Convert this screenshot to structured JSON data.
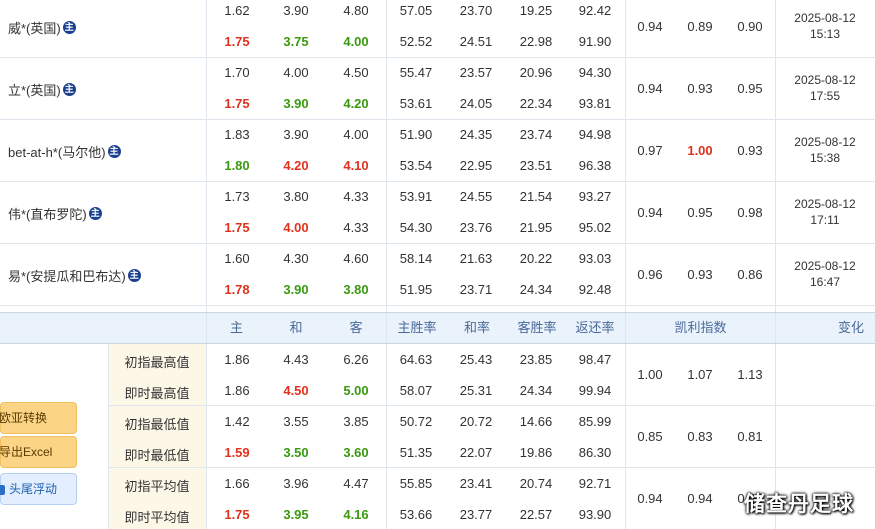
{
  "companies": [
    {
      "name": "威*(英国)",
      "badge": "主",
      "init": [
        "1.62",
        "3.90",
        "4.80",
        "57.05",
        "23.70",
        "19.25",
        "92.42"
      ],
      "live": [
        "1.75",
        "3.75",
        "4.00",
        "52.52",
        "24.51",
        "22.98",
        "91.90"
      ],
      "kelly": [
        "0.94",
        "0.89",
        "0.90"
      ],
      "date": "2025-08-12",
      "time": "15:13"
    },
    {
      "name": "立*(英国)",
      "badge": "主",
      "init": [
        "1.70",
        "4.00",
        "4.50",
        "55.47",
        "23.57",
        "20.96",
        "94.30"
      ],
      "live": [
        "1.75",
        "3.90",
        "4.20",
        "53.61",
        "24.05",
        "22.34",
        "93.81"
      ],
      "kelly": [
        "0.94",
        "0.93",
        "0.95"
      ],
      "date": "2025-08-12",
      "time": "17:55"
    },
    {
      "name": "bet-at-h*(马尔他)",
      "badge": "主",
      "init": [
        "1.83",
        "3.90",
        "4.00",
        "51.90",
        "24.35",
        "23.74",
        "94.98"
      ],
      "live": [
        "1.80",
        "4.20",
        "4.10",
        "53.54",
        "22.95",
        "23.51",
        "96.38"
      ],
      "kelly": [
        "0.97",
        "1.00",
        "0.93"
      ],
      "date": "2025-08-12",
      "time": "15:38"
    },
    {
      "name": "伟*(直布罗陀)",
      "badge": "主",
      "init": [
        "1.73",
        "3.80",
        "4.33",
        "53.91",
        "24.55",
        "21.54",
        "93.27"
      ],
      "live": [
        "1.75",
        "4.00",
        "4.33",
        "54.30",
        "23.76",
        "21.95",
        "95.02"
      ],
      "kelly": [
        "0.94",
        "0.95",
        "0.98"
      ],
      "date": "2025-08-12",
      "time": "17:11"
    },
    {
      "name": "易*(安提瓜和巴布达)",
      "badge": "主",
      "init": [
        "1.60",
        "4.30",
        "4.60",
        "58.14",
        "21.63",
        "20.22",
        "93.03"
      ],
      "live": [
        "1.78",
        "3.90",
        "3.80",
        "51.95",
        "23.71",
        "24.34",
        "92.48"
      ],
      "kelly": [
        "0.96",
        "0.93",
        "0.86"
      ],
      "date": "2025-08-12",
      "time": "16:47"
    }
  ],
  "header": {
    "cols": [
      "主",
      "和",
      "客",
      "主胜率",
      "和率",
      "客胜率",
      "返还率"
    ],
    "kelly": "凯利指数",
    "change": "变化"
  },
  "stats": [
    {
      "label": "初指最高值",
      "values": [
        "1.86",
        "4.43",
        "6.26",
        "64.63",
        "25.43",
        "23.85",
        "98.47"
      ]
    },
    {
      "label": "即时最高值",
      "values": [
        "1.86",
        "4.50",
        "5.00",
        "58.07",
        "25.31",
        "24.34",
        "99.94"
      ]
    },
    {
      "label": "初指最低值",
      "values": [
        "1.42",
        "3.55",
        "3.85",
        "50.72",
        "20.72",
        "14.66",
        "85.99"
      ]
    },
    {
      "label": "即时最低值",
      "values": [
        "1.59",
        "3.50",
        "3.60",
        "51.35",
        "22.07",
        "19.86",
        "86.30"
      ]
    },
    {
      "label": "初指平均值",
      "values": [
        "1.66",
        "3.96",
        "4.47",
        "55.85",
        "23.41",
        "20.74",
        "92.71"
      ]
    },
    {
      "label": "即时平均值",
      "values": [
        "1.75",
        "3.95",
        "4.16",
        "53.66",
        "23.77",
        "22.57",
        "93.90"
      ]
    }
  ],
  "stats_kelly": [
    [
      "1.00",
      "1.07",
      "1.13"
    ],
    [
      "0.85",
      "0.83",
      "0.81"
    ],
    [
      "0.94",
      "0.94",
      "0.93"
    ]
  ],
  "buttons": {
    "convert": "欧亚转换",
    "export": "导出Excel",
    "float": "头尾浮动"
  },
  "watermark": "储查丹足球",
  "colors": {
    "red": "#e0321e",
    "green": "#3a9a10",
    "header_bg": "#eaf2fb",
    "label_bg": "#fdf7e8"
  }
}
